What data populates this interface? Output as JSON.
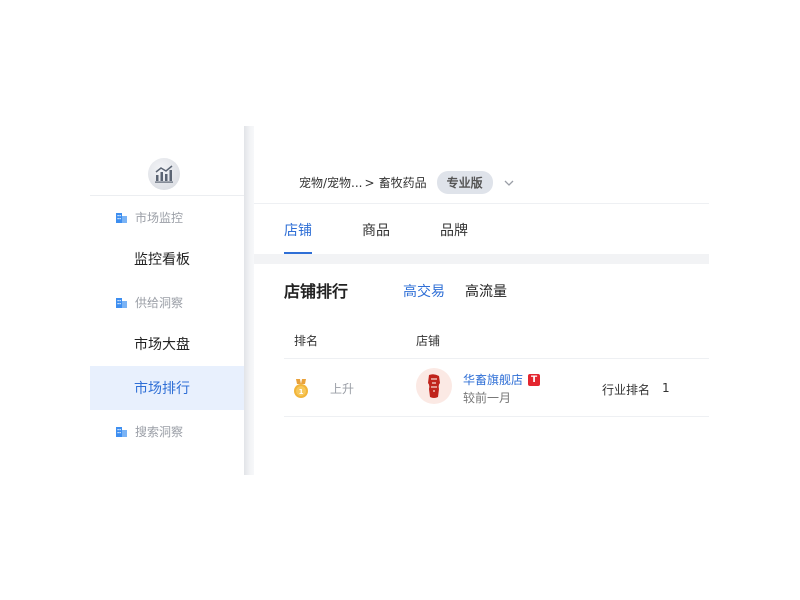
{
  "sidebar": {
    "sections": [
      {
        "label": "市场监控",
        "icon": "building-icon",
        "items": [
          "监控看板"
        ]
      },
      {
        "label": "供给洞察",
        "icon": "building-icon",
        "items": [
          "市场大盘",
          "市场排行"
        ]
      },
      {
        "label": "搜索洞察",
        "icon": "building-icon",
        "items": []
      }
    ],
    "active_item": "市场排行"
  },
  "header": {
    "breadcrumb": "宠物/宠物...",
    "breadcrumb_separator": ">",
    "category": "畜牧药品",
    "edition_badge": "专业版"
  },
  "tabs": [
    {
      "label": "店铺",
      "active": true
    },
    {
      "label": "商品",
      "active": false
    },
    {
      "label": "品牌",
      "active": false
    }
  ],
  "ranking": {
    "title": "店铺排行",
    "switches": [
      {
        "label": "高交易",
        "active": true
      },
      {
        "label": "高流量",
        "active": false
      }
    ],
    "columns": [
      "排名",
      "店铺"
    ],
    "rows": [
      {
        "medal": "gold-medal-icon",
        "trend": "上升",
        "shop_name": "华畜旗舰店",
        "shop_badge": "T",
        "compare": "较前一月",
        "rank_label": "行业排名",
        "rank_value": "1"
      }
    ]
  },
  "colors": {
    "accent": "#2f6fd6",
    "active_bg": "#e8f0fd",
    "tmall_red": "#e3262f",
    "medal_gold": "#f2b53a"
  }
}
